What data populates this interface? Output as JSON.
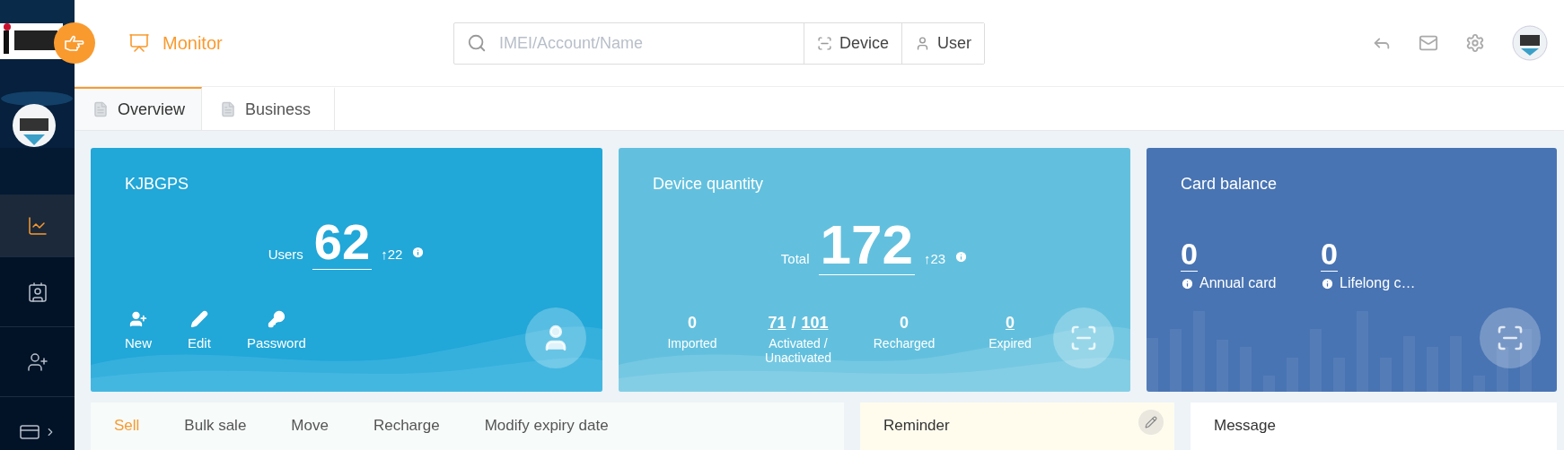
{
  "header": {
    "module": "Monitor",
    "search": {
      "placeholder": "IMEI/Account/Name",
      "options": [
        "Device",
        "User"
      ]
    }
  },
  "sidebar": {
    "items": [
      {
        "selected": true
      },
      {
        "selected": false
      },
      {
        "selected": false
      },
      {
        "selected": false,
        "has_submenu": true
      }
    ]
  },
  "tabs": [
    {
      "label": "Overview",
      "selected": true
    },
    {
      "label": "Business",
      "selected": false
    }
  ],
  "account_card": {
    "title": "KJBGPS",
    "metric": {
      "label": "Users",
      "value": "62",
      "delta": "↑22"
    },
    "actions": [
      "New",
      "Edit",
      "Password"
    ]
  },
  "device_card": {
    "title": "Device quantity",
    "metric": {
      "label": "Total",
      "value": "172",
      "delta": "↑23"
    },
    "stats": [
      {
        "values": [
          "0"
        ],
        "label": "Imported",
        "link": false
      },
      {
        "values": [
          "71",
          "101"
        ],
        "separator": "/",
        "label": "Activated / Unactivated",
        "link": true
      },
      {
        "values": [
          "0"
        ],
        "label": "Recharged",
        "link": false
      },
      {
        "values": [
          "0"
        ],
        "label": "Expired",
        "link": true
      }
    ]
  },
  "balance_card": {
    "title": "Card balance",
    "items": [
      {
        "value": "0",
        "label": "Annual card"
      },
      {
        "value": "0",
        "label": "Lifelong c…"
      }
    ]
  },
  "operations": {
    "tabs": [
      {
        "label": "Sell",
        "selected": true
      },
      {
        "label": "Bulk sale",
        "selected": false
      },
      {
        "label": "Move",
        "selected": false
      },
      {
        "label": "Recharge",
        "selected": false
      },
      {
        "label": "Modify expiry date",
        "selected": false
      }
    ]
  },
  "reminder": {
    "title": "Reminder"
  },
  "message": {
    "title": "Message"
  }
}
